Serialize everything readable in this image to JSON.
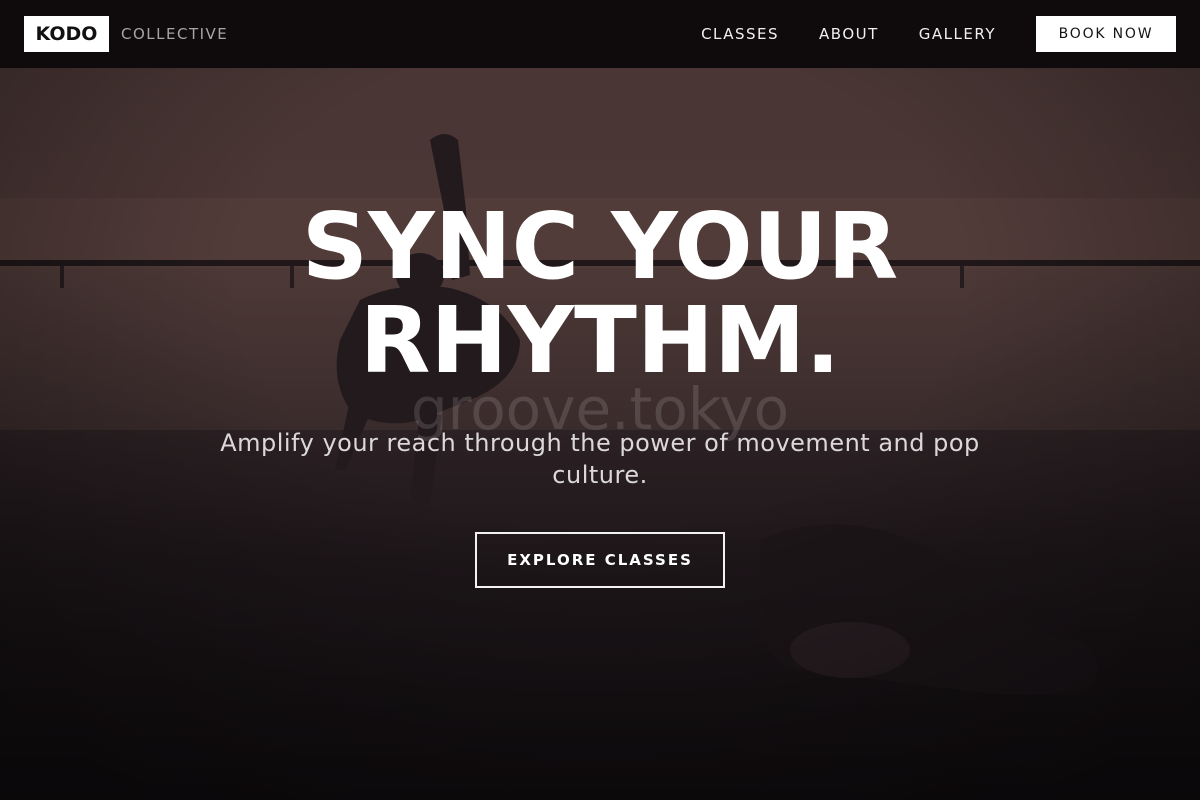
{
  "brand": {
    "logo": "KODO",
    "subtitle": "COLLECTIVE"
  },
  "nav": {
    "items": [
      {
        "label": "CLASSES"
      },
      {
        "label": "ABOUT"
      },
      {
        "label": "GALLERY"
      }
    ],
    "cta_label": "BOOK NOW"
  },
  "hero": {
    "title_line1": "SYNC YOUR",
    "title_line2": "RHYTHM.",
    "watermark": "groove.tokyo",
    "subtitle": "Amplify your reach through the power of movement and pop culture.",
    "cta_label": "EXPLORE CLASSES"
  },
  "colors": {
    "background": "#141013",
    "navbar": "#0f0b0c",
    "button_bg": "#ffffff",
    "text_primary": "#ffffff"
  }
}
